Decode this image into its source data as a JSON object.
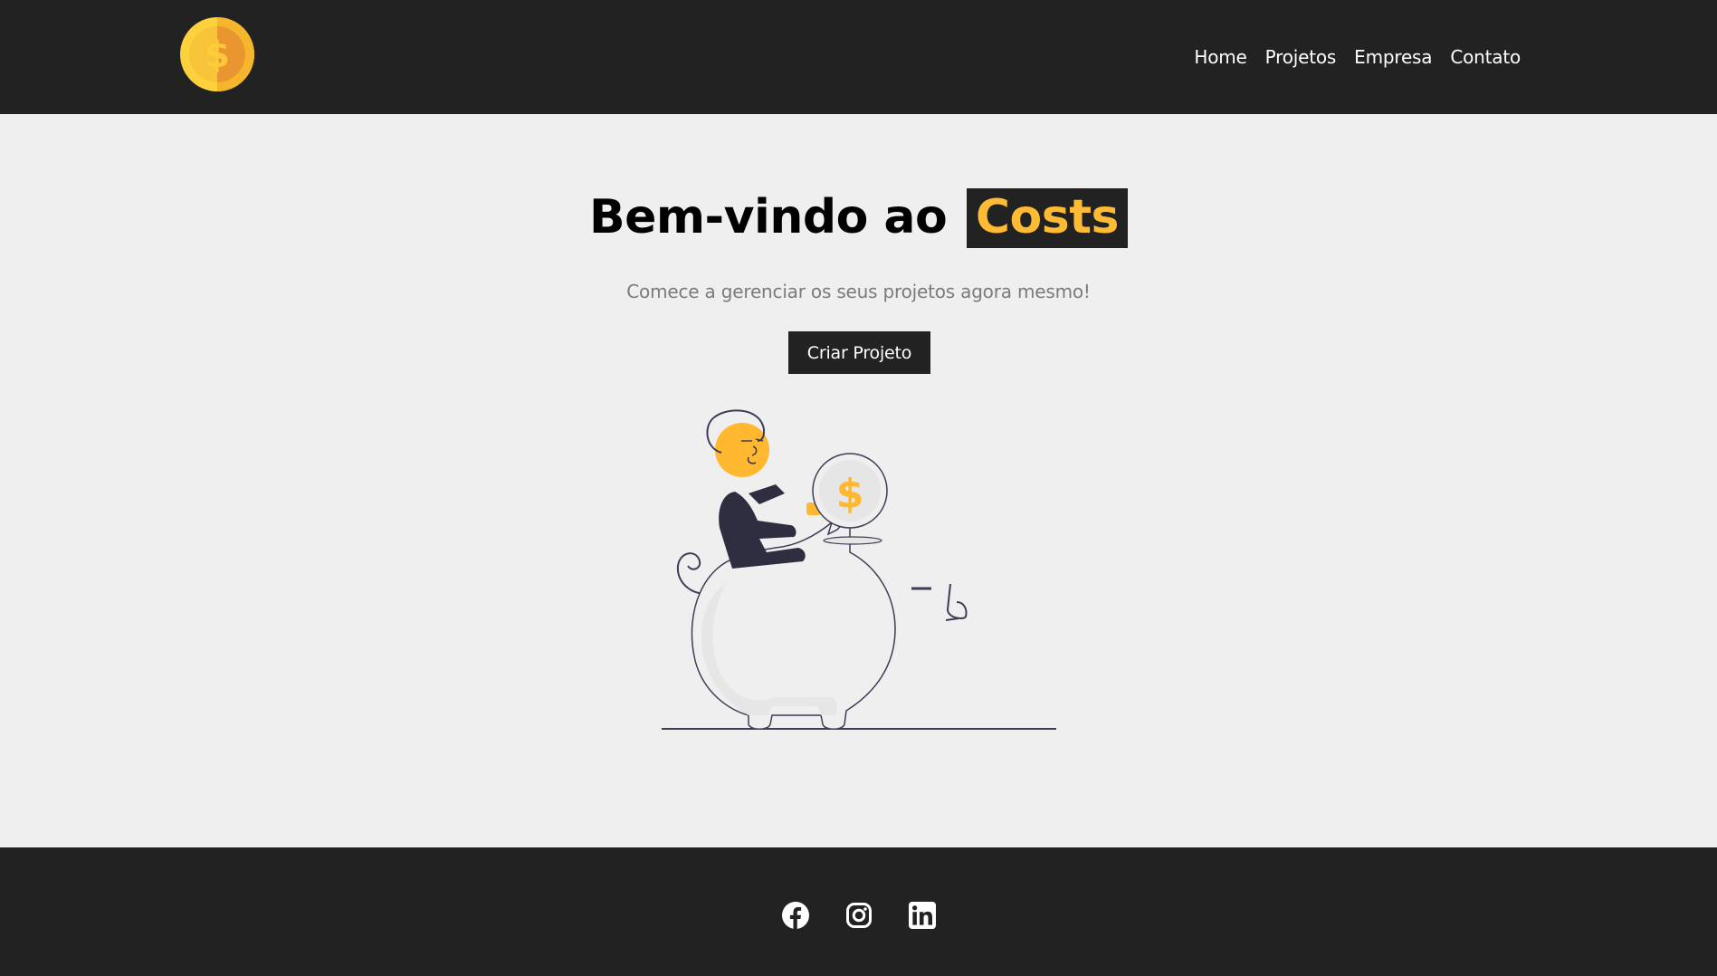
{
  "navbar": {
    "logo": "dollar-coin-logo",
    "links": [
      "Home",
      "Projetos",
      "Empresa",
      "Contato"
    ]
  },
  "hero": {
    "title_prefix": "Bem-vindo ao",
    "title_brand": "Costs",
    "subtitle": "Comece a gerenciar os seus projetos agora mesmo!",
    "cta_label": "Criar Projeto",
    "illustration": "piggy-bank-savings-illustration"
  },
  "footer": {
    "social_icons": [
      "facebook-icon",
      "instagram-icon",
      "linkedin-icon"
    ]
  },
  "colors": {
    "dark": "#222222",
    "accent": "#ffbb33",
    "background": "#efefef",
    "muted_text": "#7b7b7b"
  }
}
